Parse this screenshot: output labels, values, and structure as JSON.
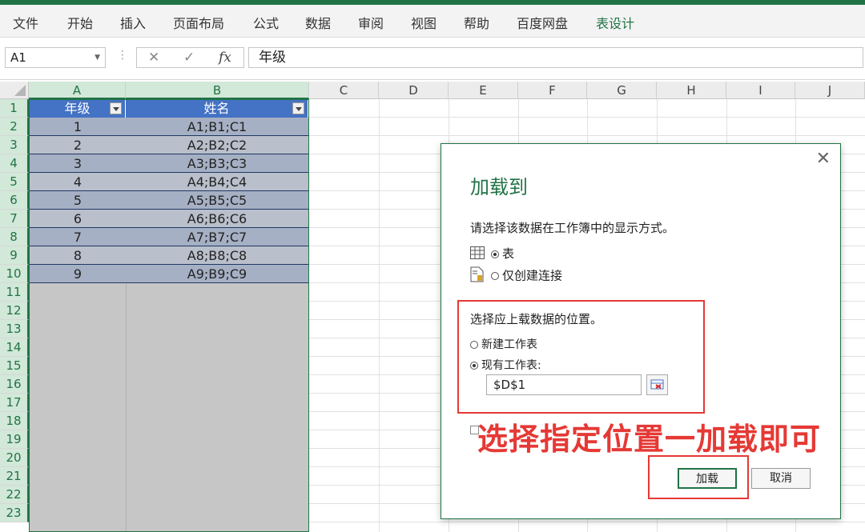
{
  "ribbon": {
    "tabs": [
      {
        "label": "文件",
        "active": false
      },
      {
        "label": "开始",
        "active": false
      },
      {
        "label": "插入",
        "active": false
      },
      {
        "label": "页面布局",
        "active": false
      },
      {
        "label": "公式",
        "active": false
      },
      {
        "label": "数据",
        "active": false
      },
      {
        "label": "审阅",
        "active": false
      },
      {
        "label": "视图",
        "active": false
      },
      {
        "label": "帮助",
        "active": false
      },
      {
        "label": "百度网盘",
        "active": false
      },
      {
        "label": "表设计",
        "active": true
      }
    ],
    "accent": "#217346"
  },
  "formula_bar": {
    "name_box": "A1",
    "cancel_icon": "✕",
    "enter_icon": "✓",
    "fx_icon": "fx",
    "content": "年级"
  },
  "sheet": {
    "columns": [
      "A",
      "B",
      "C",
      "D",
      "E",
      "F",
      "G",
      "H",
      "I",
      "J"
    ],
    "rows": [
      "1",
      "2",
      "3",
      "4",
      "5",
      "6",
      "7",
      "8",
      "9",
      "10",
      "11",
      "12",
      "13",
      "14",
      "15",
      "16",
      "17",
      "18",
      "19",
      "20",
      "21",
      "22",
      "23"
    ],
    "table": {
      "headers": [
        "年级",
        "姓名"
      ],
      "rows": [
        [
          "1",
          "A1;B1;C1"
        ],
        [
          "2",
          "A2;B2;C2"
        ],
        [
          "3",
          "A3;B3;C3"
        ],
        [
          "4",
          "A4;B4;C4"
        ],
        [
          "5",
          "A5;B5;C5"
        ],
        [
          "6",
          "A6;B6;C6"
        ],
        [
          "7",
          "A7;B7;C7"
        ],
        [
          "8",
          "A8;B8;C8"
        ],
        [
          "9",
          "A9;B9;C9"
        ]
      ],
      "header_color": "#4472c4"
    }
  },
  "dialog": {
    "title": "加载到",
    "close_label": "✕",
    "prompt": "请选择该数据在工作簿中的显示方式。",
    "display_options": [
      {
        "label": "表",
        "checked": true,
        "icon": "table-icon"
      },
      {
        "label": "仅创建连接",
        "checked": false,
        "icon": "connection-icon"
      }
    ],
    "location_prompt": "选择应上载数据的位置。",
    "location_options": [
      {
        "label": "新建工作表",
        "checked": false
      },
      {
        "label": "现有工作表:",
        "checked": true
      }
    ],
    "reference": "$D$1",
    "load_button": "加载",
    "cancel_button": "取消"
  },
  "annotation": {
    "text": "选择指定位置一加载即可",
    "color": "#e53935"
  }
}
